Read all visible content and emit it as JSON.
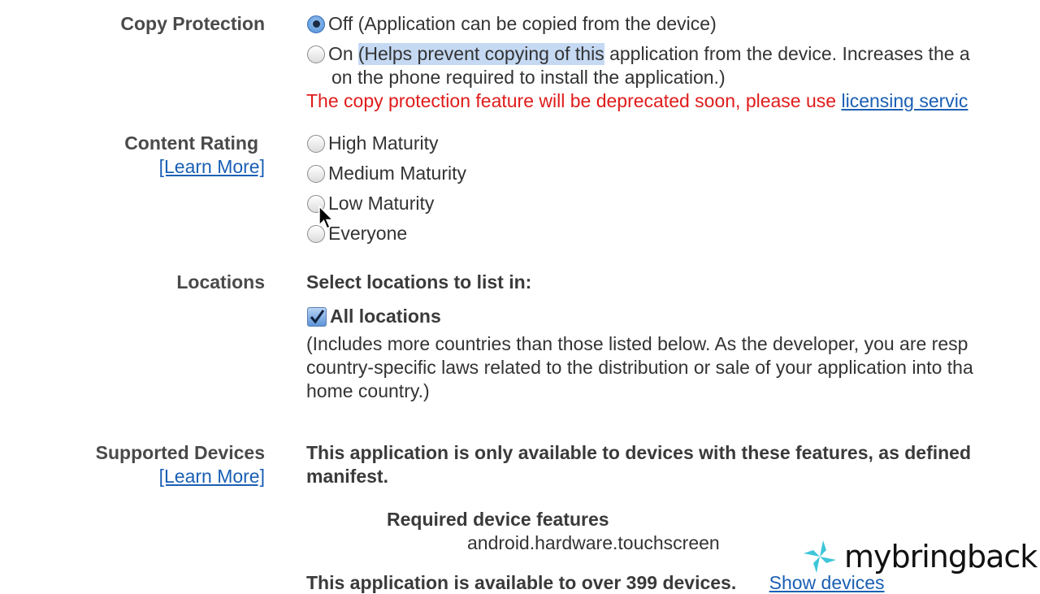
{
  "copy_protection": {
    "label": "Copy Protection",
    "off_label": "Off (Application can be copied from the device)",
    "on_prefix": "On",
    "on_highlight": "(Helps prevent copying of this",
    "on_rest": " application from the device. Increases the a",
    "on_line2": "on the phone required to install the application.)",
    "warning": "The copy protection feature will be deprecated soon, please use ",
    "warning_link": "licensing servic"
  },
  "content_rating": {
    "label": "Content Rating",
    "learn_more": "[Learn More]",
    "options": [
      "High Maturity",
      "Medium Maturity",
      "Low Maturity",
      "Everyone"
    ]
  },
  "locations": {
    "label": "Locations",
    "heading": "Select locations to list in:",
    "all_locations": "All locations",
    "desc_line1": "(Includes more countries than those listed below. As the developer, you are resp",
    "desc_line2": "country-specific laws related to the distribution or sale of your application into tha",
    "desc_line3": "home country.)"
  },
  "supported_devices": {
    "label": "Supported Devices",
    "learn_more": "[Learn More]",
    "desc_line1": "This application is only available to devices with these features, as defined",
    "desc_line2": "manifest.",
    "required_heading": "Required device features",
    "feature": "android.hardware.touchscreen",
    "available_text": "This application is available to over 399 devices.",
    "show_devices": "Show devices"
  },
  "watermark": {
    "brand": "mybringback"
  },
  "colors": {
    "link": "#1a5fb4",
    "warning": "#e01b1b",
    "highlight": "#c5d9f3"
  }
}
